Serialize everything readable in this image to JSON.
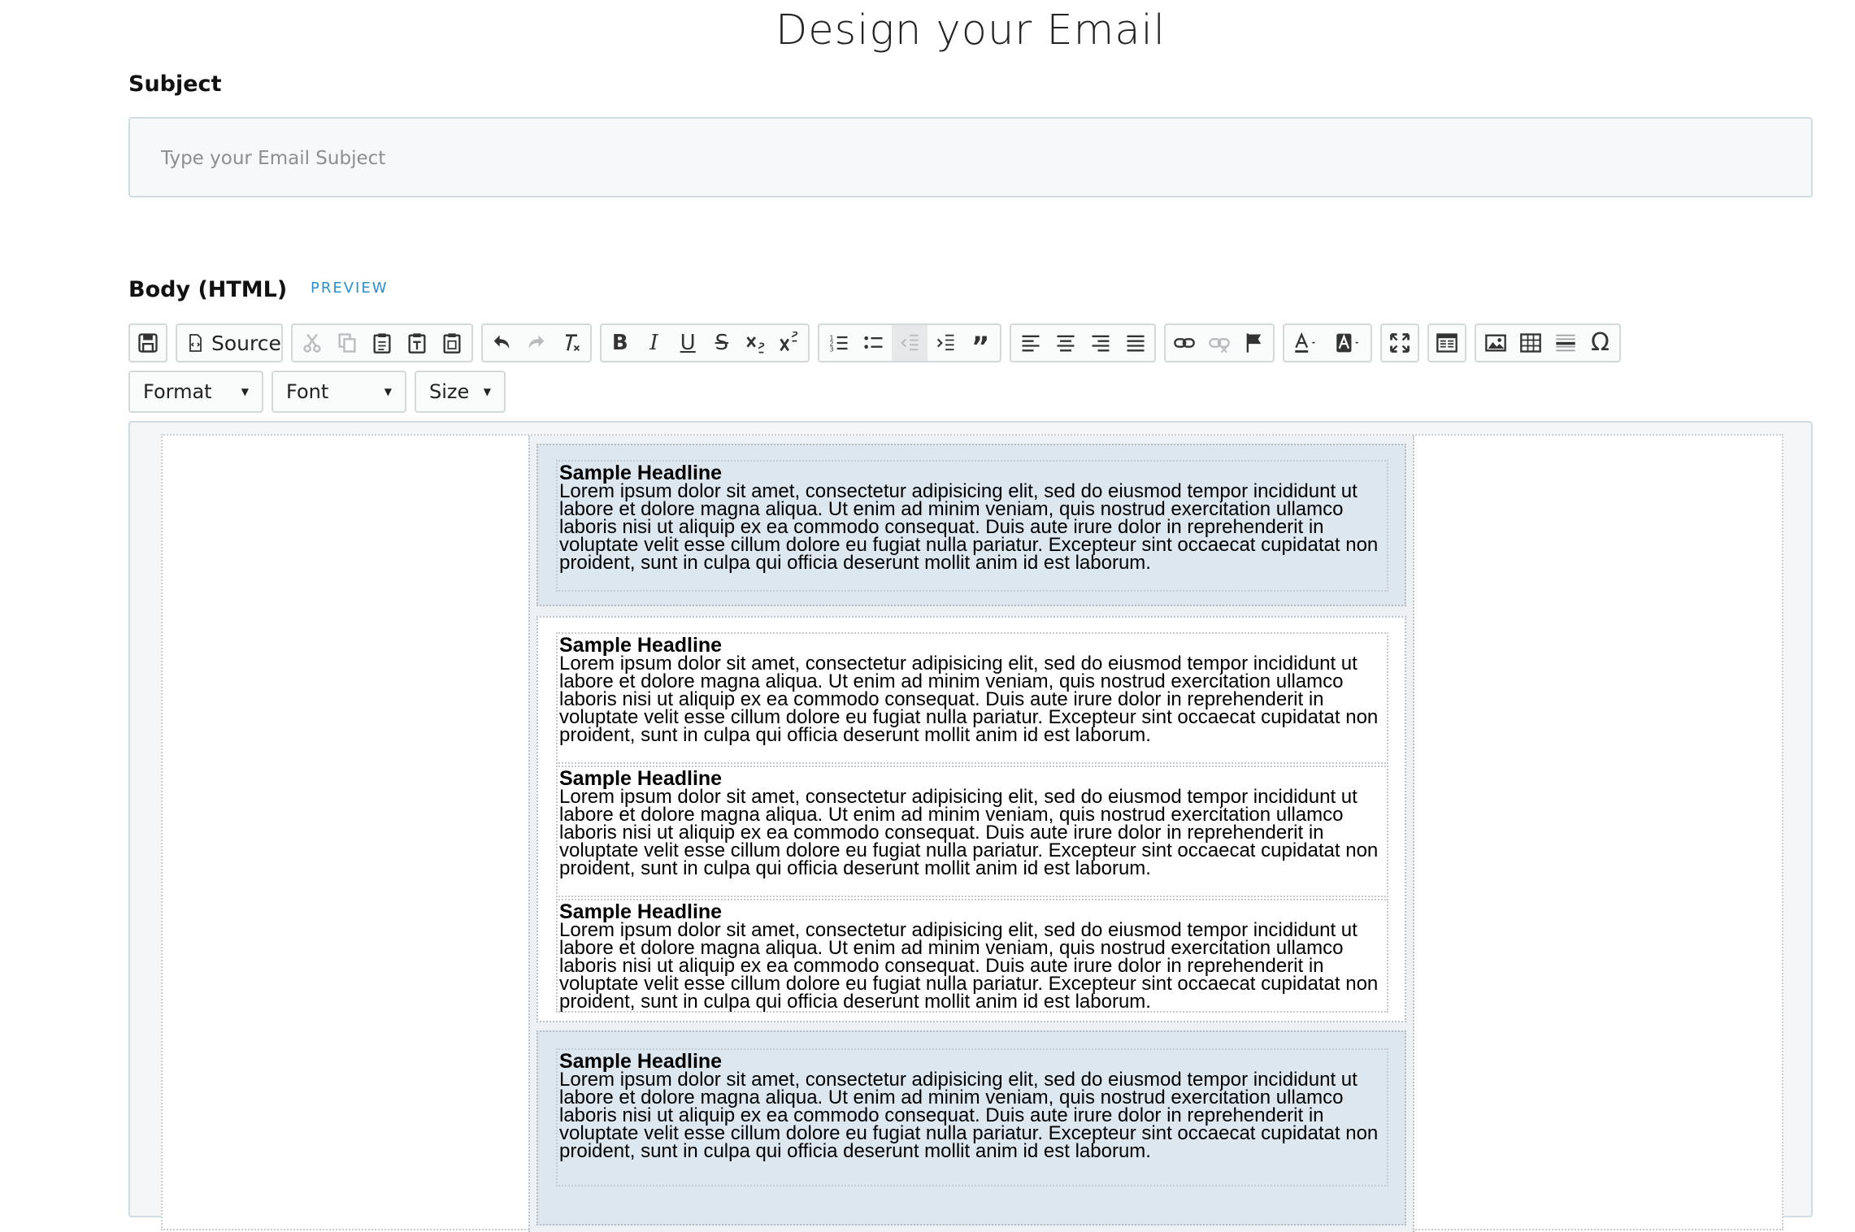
{
  "page": {
    "title": "Design your Email"
  },
  "subject": {
    "label": "Subject",
    "placeholder": "Type your Email Subject",
    "value": ""
  },
  "body": {
    "label": "Body (HTML)",
    "preview_label": "PREVIEW"
  },
  "toolbar": {
    "source_label": "Source",
    "format_label": "Format",
    "font_label": "Font",
    "size_label": "Size"
  },
  "content": {
    "blocks": [
      {
        "headline": "Sample Headline",
        "text": "Lorem ipsum dolor sit amet, consectetur adipisicing elit, sed do eiusmod tempor incididunt ut labore et dolore magna aliqua. Ut enim ad minim veniam, quis nostrud exercitation ullamco laboris nisi ut aliquip ex ea commodo consequat. Duis aute irure dolor in reprehenderit in voluptate velit esse cillum dolore eu fugiat nulla pariatur. Excepteur sint occaecat cupidatat non proident, sunt in culpa qui officia deserunt mollit anim id est laborum."
      },
      {
        "headline": "Sample Headline",
        "text": "Lorem ipsum dolor sit amet, consectetur adipisicing elit, sed do eiusmod tempor incididunt ut labore et dolore magna aliqua. Ut enim ad minim veniam, quis nostrud exercitation ullamco laboris nisi ut aliquip ex ea commodo consequat. Duis aute irure dolor in reprehenderit in voluptate velit esse cillum dolore eu fugiat nulla pariatur. Excepteur sint occaecat cupidatat non proident, sunt in culpa qui officia deserunt mollit anim id est laborum."
      },
      {
        "headline": "Sample Headline",
        "text": "Lorem ipsum dolor sit amet, consectetur adipisicing elit, sed do eiusmod tempor incididunt ut labore et dolore magna aliqua. Ut enim ad minim veniam, quis nostrud exercitation ullamco laboris nisi ut aliquip ex ea commodo consequat. Duis aute irure dolor in reprehenderit in voluptate velit esse cillum dolore eu fugiat nulla pariatur. Excepteur sint occaecat cupidatat non proident, sunt in culpa qui officia deserunt mollit anim id est laborum."
      },
      {
        "headline": "Sample Headline",
        "text": "Lorem ipsum dolor sit amet, consectetur adipisicing elit, sed do eiusmod tempor incididunt ut labore et dolore magna aliqua. Ut enim ad minim veniam, quis nostrud exercitation ullamco laboris nisi ut aliquip ex ea commodo consequat. Duis aute irure dolor in reprehenderit in voluptate velit esse cillum dolore eu fugiat nulla pariatur. Excepteur sint occaecat cupidatat non proident, sunt in culpa qui officia deserunt mollit anim id est laborum."
      },
      {
        "headline": "Sample Headline",
        "text": "Lorem ipsum dolor sit amet, consectetur adipisicing elit, sed do eiusmod tempor incididunt ut labore et dolore magna aliqua. Ut enim ad minim veniam, quis nostrud exercitation ullamco laboris nisi ut aliquip ex ea commodo consequat. Duis aute irure dolor in reprehenderit in voluptate velit esse cillum dolore eu fugiat nulla pariatur. Excepteur sint occaecat cupidatat non proident, sunt in culpa qui officia deserunt mollit anim id est laborum."
      }
    ]
  },
  "colors": {
    "accent_link": "#2b8fcf",
    "section_blue": "#dce7ef",
    "input_border": "#cfdde2"
  }
}
